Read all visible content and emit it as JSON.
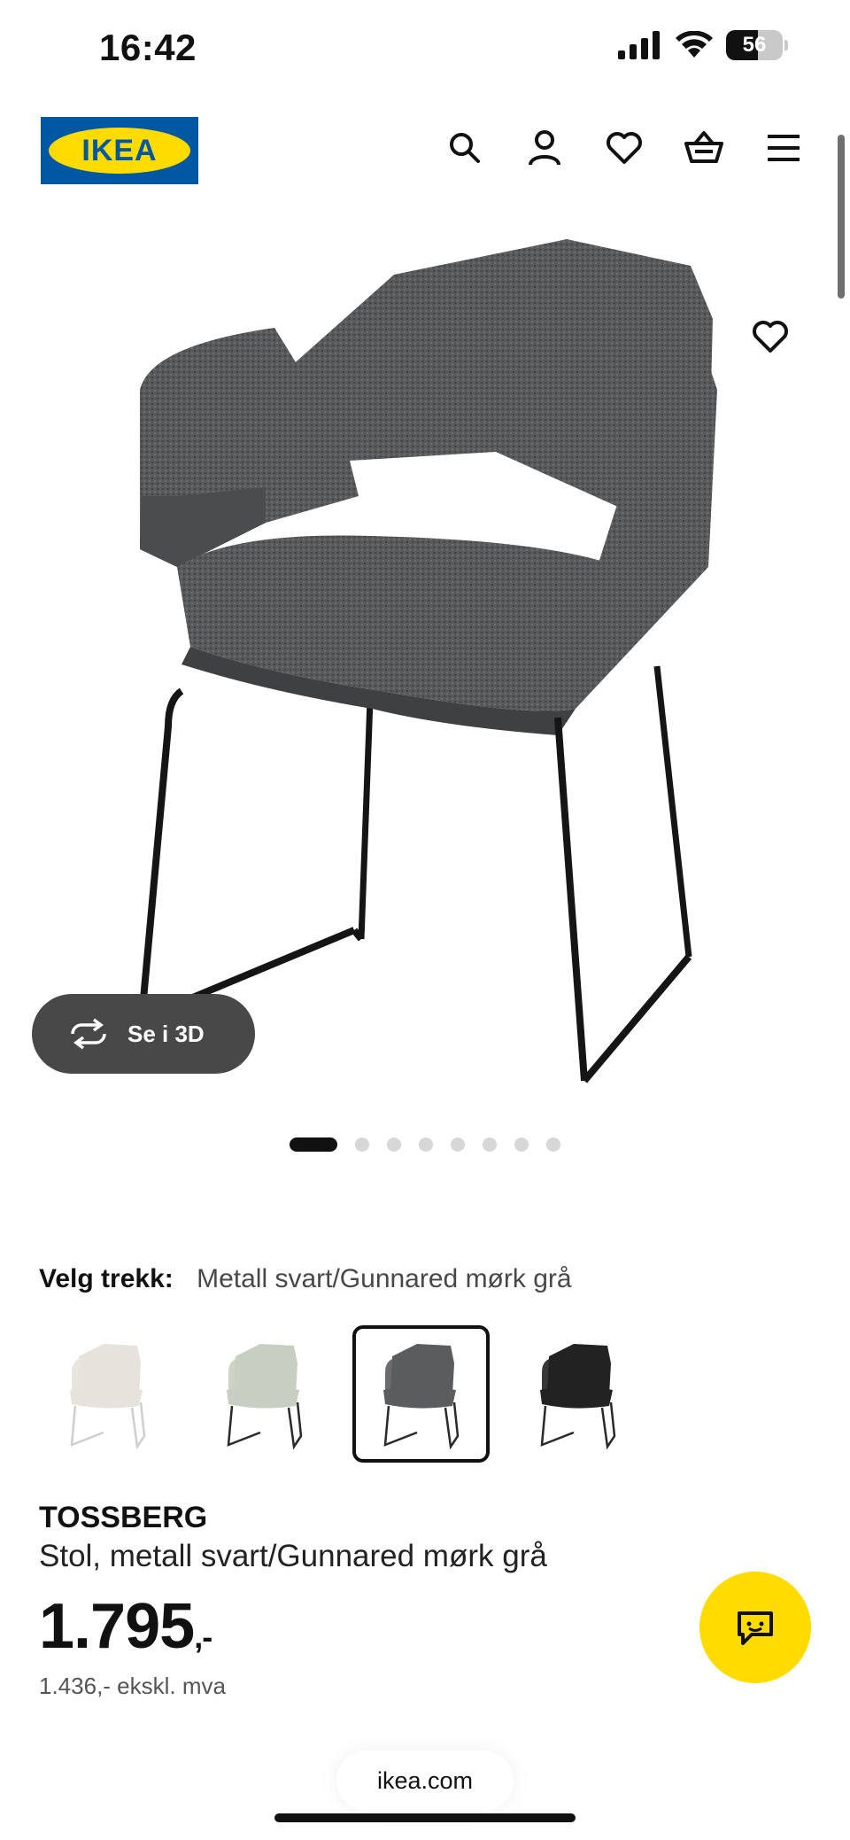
{
  "status_bar": {
    "time": "16:42",
    "battery": "56",
    "battery_level": 0.56
  },
  "header": {
    "logo_text": "IKEA",
    "icons": [
      "search-icon",
      "account-icon",
      "heart-icon",
      "basket-icon",
      "menu-icon"
    ]
  },
  "gallery": {
    "view_3d_label": "Se i 3D",
    "dots_count": 8,
    "active_index": 0
  },
  "variant": {
    "label": "Velg trekk:",
    "selected": "Metall svart/Gunnared mørk grå",
    "options": [
      {
        "color": "#e6e3dc",
        "legs": "#cfcfcf"
      },
      {
        "color": "#c6cfc2",
        "legs": "#2a2a2a"
      },
      {
        "color": "#5b5c5e",
        "legs": "#2a2a2a"
      },
      {
        "color": "#222222",
        "legs": "#2a2a2a"
      }
    ],
    "selected_index": 2
  },
  "product": {
    "name": "TOSSBERG",
    "description": "Stol, metall svart/Gunnared mørk grå",
    "price": "1.795",
    "price_suffix": ",-",
    "price_ex_vat": "1.436,- ekskl. mva"
  },
  "browser": {
    "url": "ikea.com"
  },
  "colors": {
    "ikea_blue": "#0058a3",
    "ikea_yellow": "#ffdb00"
  }
}
